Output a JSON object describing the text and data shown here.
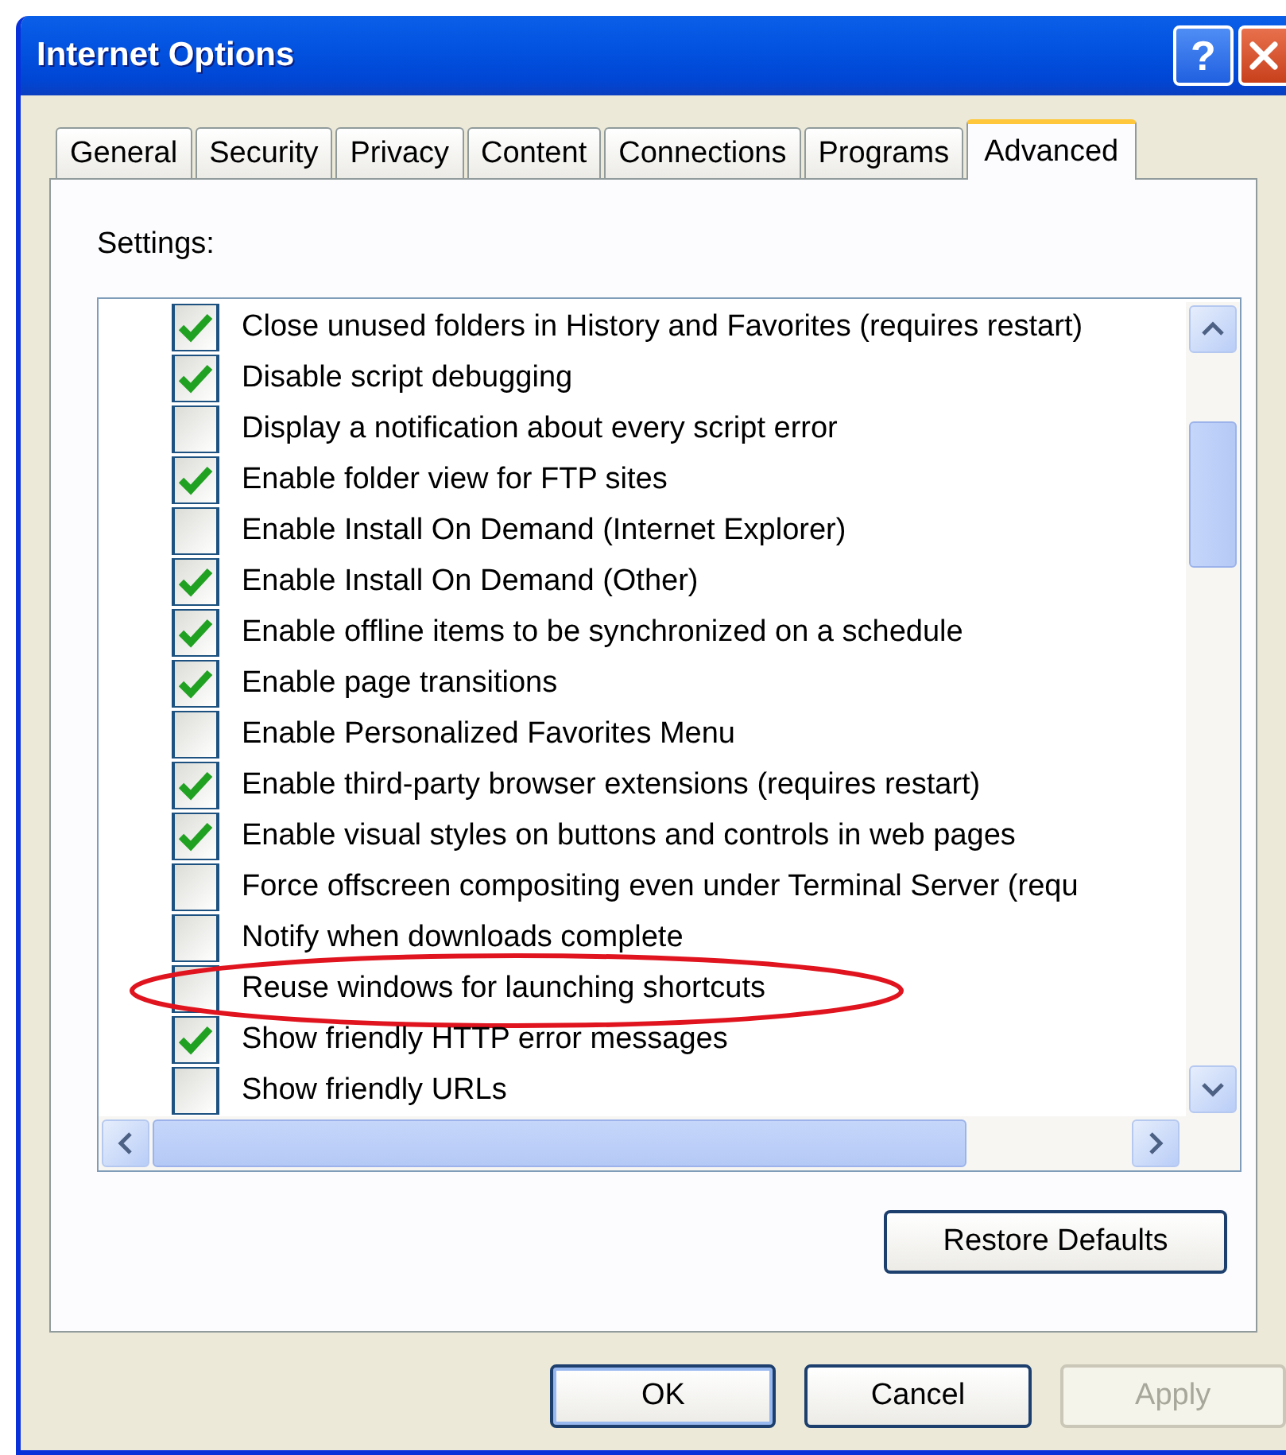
{
  "window": {
    "title": "Internet Options",
    "help_button": "?"
  },
  "tabs": [
    {
      "label": "General",
      "selected": false
    },
    {
      "label": "Security",
      "selected": false
    },
    {
      "label": "Privacy",
      "selected": false
    },
    {
      "label": "Content",
      "selected": false
    },
    {
      "label": "Connections",
      "selected": false
    },
    {
      "label": "Programs",
      "selected": false
    },
    {
      "label": "Advanced",
      "selected": true
    }
  ],
  "settings": {
    "label": "Settings:",
    "items": [
      {
        "label": "Close unused folders in History and Favorites (requires restart)",
        "checked": true,
        "circled": false
      },
      {
        "label": "Disable script debugging",
        "checked": true,
        "circled": false
      },
      {
        "label": "Display a notification about every script error",
        "checked": false,
        "circled": false
      },
      {
        "label": "Enable folder view for FTP sites",
        "checked": true,
        "circled": false
      },
      {
        "label": "Enable Install On Demand (Internet Explorer)",
        "checked": false,
        "circled": false
      },
      {
        "label": "Enable Install On Demand (Other)",
        "checked": true,
        "circled": false
      },
      {
        "label": "Enable offline items to be synchronized on a schedule",
        "checked": true,
        "circled": false
      },
      {
        "label": "Enable page transitions",
        "checked": true,
        "circled": false
      },
      {
        "label": "Enable Personalized Favorites Menu",
        "checked": false,
        "circled": false
      },
      {
        "label": "Enable third-party browser extensions (requires restart)",
        "checked": true,
        "circled": false
      },
      {
        "label": "Enable visual styles on buttons and controls in web pages",
        "checked": true,
        "circled": false
      },
      {
        "label": "Force offscreen compositing even under Terminal Server (requ",
        "checked": false,
        "circled": false
      },
      {
        "label": "Notify when downloads complete",
        "checked": false,
        "circled": false
      },
      {
        "label": "Reuse windows for launching shortcuts",
        "checked": false,
        "circled": true
      },
      {
        "label": "Show friendly HTTP error messages",
        "checked": true,
        "circled": false
      },
      {
        "label": "Show friendly URLs",
        "checked": false,
        "circled": false
      }
    ]
  },
  "restore_button": {
    "label": "Restore Defaults"
  },
  "buttons": [
    {
      "label": "OK",
      "disabled": false,
      "default": true
    },
    {
      "label": "Cancel",
      "disabled": false,
      "default": false
    },
    {
      "label": "Apply",
      "disabled": true,
      "default": false
    }
  ]
}
